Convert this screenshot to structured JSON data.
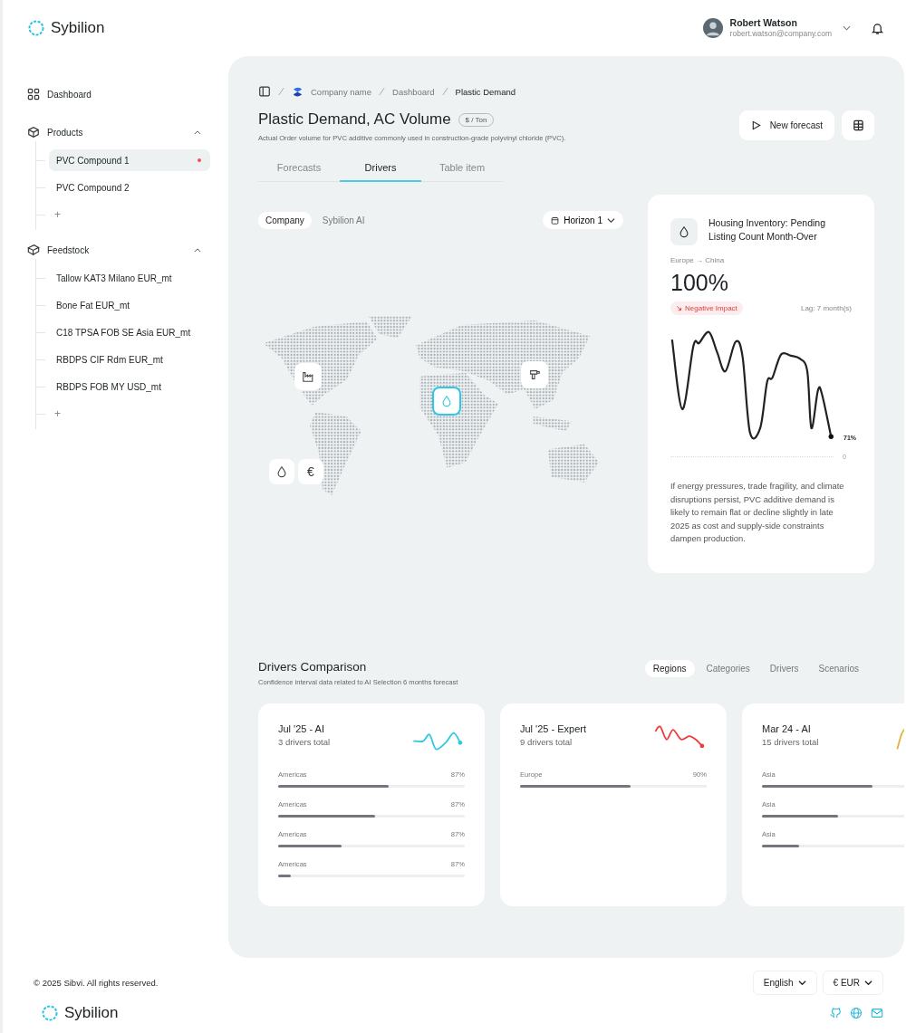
{
  "brand": {
    "name": "Sybilion"
  },
  "user": {
    "name": "Robert Watson",
    "email": "robert.watson@company.com"
  },
  "sidebar": {
    "items": [
      {
        "kind": "link",
        "label": "Dashboard"
      },
      {
        "kind": "group",
        "label": "Products",
        "expanded": true,
        "children": [
          {
            "label": "PVC Compound 1",
            "selected": true,
            "alert": true
          },
          {
            "label": "PVC Compound 2",
            "selected": false,
            "alert": false
          }
        ],
        "add": "+"
      },
      {
        "kind": "group",
        "label": "Feedstock",
        "expanded": true,
        "children": [
          {
            "label": "Tallow KAT3 Milano EUR_mt",
            "selected": false,
            "alert": false
          },
          {
            "label": "Bone Fat EUR_mt",
            "selected": false,
            "alert": false
          },
          {
            "label": "C18 TPSA FOB SE Asia EUR_mt",
            "selected": false,
            "alert": false
          },
          {
            "label": "RBDPS CIF Rdm EUR_mt",
            "selected": false,
            "alert": false
          },
          {
            "label": "RBDPS FOB MY USD_mt",
            "selected": false,
            "alert": false
          }
        ],
        "add": "+"
      }
    ]
  },
  "breadcrumb": [
    {
      "label": "Company name",
      "current": false
    },
    {
      "label": "Dashboard",
      "current": false
    },
    {
      "label": "Plastic Demand",
      "current": true
    }
  ],
  "header": {
    "title": "Plastic Demand, AC Volume",
    "unit": "$ / Ton",
    "description": "Actual Order volume for PVC additive commonly used in construction-grade polyvinyl chloride (PVC).",
    "action": "New forecast"
  },
  "tabs": [
    {
      "label": "Forecasts",
      "selected": false
    },
    {
      "label": "Drivers",
      "selected": true
    },
    {
      "label": "Table item",
      "selected": false
    }
  ],
  "map_panel": {
    "sources": [
      {
        "label": "Company",
        "selected": true
      },
      {
        "label": "Sybilion AI",
        "selected": false
      }
    ],
    "horizon": "Horizon 1",
    "markers": [
      {
        "kind": "factory",
        "selected": false
      },
      {
        "kind": "drill",
        "selected": false
      },
      {
        "kind": "droplet",
        "selected": true
      }
    ],
    "filters": [
      {
        "kind": "droplet"
      },
      {
        "kind": "currency",
        "symbol": "€"
      }
    ]
  },
  "driver_card": {
    "title": "Housing Inventory: Pending Listing Count Month-Over",
    "route": "Europe → China",
    "value": "100%",
    "impact": "Negative Impact",
    "lag": "Lag: 7 month(s)",
    "end_label": "71%",
    "baseline_label": "0",
    "text": "If energy pressures, trade fragility, and climate disruptions persist, PVC additive demand is likely to remain flat or decline slightly in late 2025 as cost and supply-side constraints dampen production."
  },
  "comparison": {
    "title": "Drivers Comparison",
    "subtitle": "Confidence interval data related to AI Selection 6 months forecast",
    "tabs": [
      {
        "label": "Regions",
        "selected": true
      },
      {
        "label": "Categories",
        "selected": false
      },
      {
        "label": "Drivers",
        "selected": false
      },
      {
        "label": "Scenarios",
        "selected": false
      }
    ],
    "cards": [
      {
        "title": "Jul '25 - AI",
        "subtitle": "3 drivers total",
        "color": "#2ec8e4",
        "rows": [
          {
            "label": "Americas",
            "value": "87%",
            "level": 0.59
          },
          {
            "label": "Americas",
            "value": "87%",
            "level": 0.52
          },
          {
            "label": "Americas",
            "value": "87%",
            "level": 0.34
          },
          {
            "label": "Americas",
            "value": "87%",
            "level": 0.07
          }
        ]
      },
      {
        "title": "Jul '25 - Expert",
        "subtitle": "9 drivers total",
        "color": "#f03a3a",
        "rows": [
          {
            "label": "Europe",
            "value": "90%",
            "level": 0.59
          }
        ]
      },
      {
        "title": "Mar 24 - AI",
        "subtitle": "15 drivers total",
        "color": "#e0b040",
        "rows": [
          {
            "label": "Asia",
            "level": 0.59
          },
          {
            "label": "Asia",
            "level": 0.41
          },
          {
            "label": "Asia",
            "level": 0.2
          }
        ]
      }
    ]
  },
  "footer": {
    "copyright": "© 2025 Sibvi. All rights reserved.",
    "language": "English",
    "currency": "€ EUR",
    "brand": "Sybilion"
  }
}
